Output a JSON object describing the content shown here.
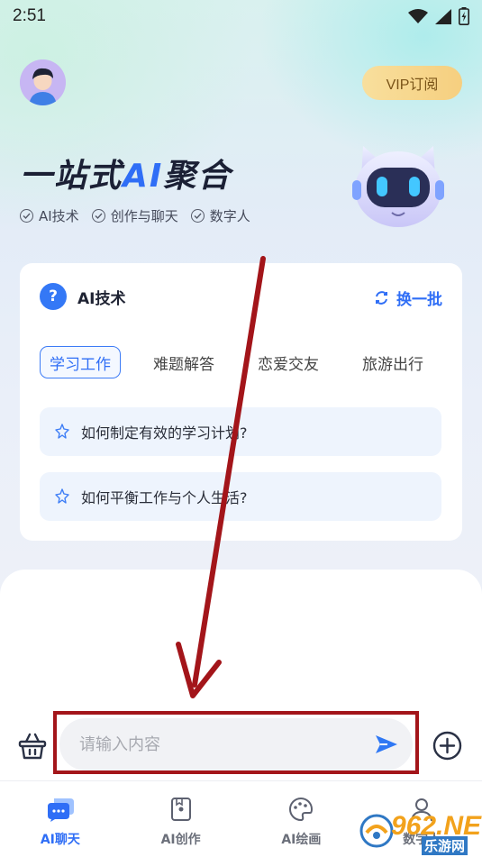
{
  "status_bar": {
    "time": "2:51"
  },
  "header": {
    "vip_label": "VIP订阅"
  },
  "hero": {
    "headline_pre": "一站式",
    "headline_ai": "AI",
    "headline_post": "聚合",
    "features": [
      "AI技术",
      "创作与聊天",
      "数字人"
    ]
  },
  "card": {
    "title": "AI技术",
    "refresh_label": "换一批",
    "tabs": [
      {
        "label": "学习工作",
        "active": true
      },
      {
        "label": "难题解答",
        "active": false
      },
      {
        "label": "恋爱交友",
        "active": false
      },
      {
        "label": "旅游出行",
        "active": false
      }
    ],
    "questions": [
      "如何制定有效的学习计划?",
      "如何平衡工作与个人生活?"
    ]
  },
  "input": {
    "placeholder": "请输入内容"
  },
  "nav": {
    "items": [
      {
        "label": "AI聊天",
        "icon": "chat-bubble-icon",
        "active": true
      },
      {
        "label": "AI创作",
        "icon": "create-card-icon",
        "active": false
      },
      {
        "label": "AI绘画",
        "icon": "palette-icon",
        "active": false
      },
      {
        "label": "数字人",
        "icon": "digital-person-icon",
        "active": false
      }
    ]
  },
  "watermark": {
    "brand": "962.NET",
    "sub": "乐游网"
  },
  "colors": {
    "accent": "#2f6ef6",
    "annotation": "#a3151a",
    "vip": "#f6cf7f"
  }
}
